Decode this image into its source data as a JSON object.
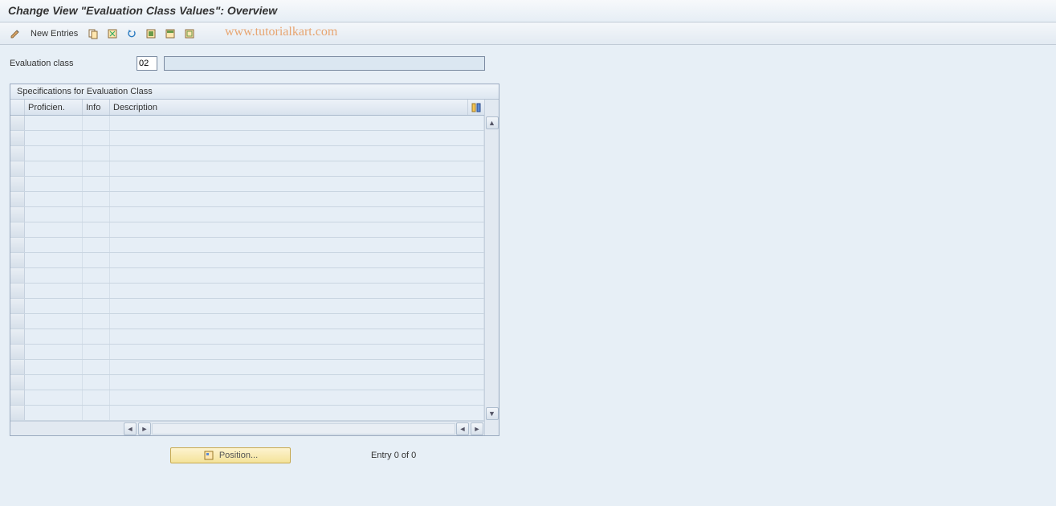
{
  "header": {
    "title": "Change View \"Evaluation Class Values\": Overview"
  },
  "toolbar": {
    "new_entries_label": "New Entries"
  },
  "watermark": "www.tutorialkart.com",
  "form": {
    "eval_class_label": "Evaluation class",
    "eval_class_value": "02",
    "eval_class_desc": ""
  },
  "panel": {
    "title": "Specifications for Evaluation Class",
    "columns": {
      "proficiency": "Proficien.",
      "info": "Info",
      "description": "Description"
    },
    "rows": [
      {
        "proficiency": "",
        "info": "",
        "description": ""
      },
      {
        "proficiency": "",
        "info": "",
        "description": ""
      },
      {
        "proficiency": "",
        "info": "",
        "description": ""
      },
      {
        "proficiency": "",
        "info": "",
        "description": ""
      },
      {
        "proficiency": "",
        "info": "",
        "description": ""
      },
      {
        "proficiency": "",
        "info": "",
        "description": ""
      },
      {
        "proficiency": "",
        "info": "",
        "description": ""
      },
      {
        "proficiency": "",
        "info": "",
        "description": ""
      },
      {
        "proficiency": "",
        "info": "",
        "description": ""
      },
      {
        "proficiency": "",
        "info": "",
        "description": ""
      },
      {
        "proficiency": "",
        "info": "",
        "description": ""
      },
      {
        "proficiency": "",
        "info": "",
        "description": ""
      },
      {
        "proficiency": "",
        "info": "",
        "description": ""
      },
      {
        "proficiency": "",
        "info": "",
        "description": ""
      },
      {
        "proficiency": "",
        "info": "",
        "description": ""
      },
      {
        "proficiency": "",
        "info": "",
        "description": ""
      },
      {
        "proficiency": "",
        "info": "",
        "description": ""
      },
      {
        "proficiency": "",
        "info": "",
        "description": ""
      },
      {
        "proficiency": "",
        "info": "",
        "description": ""
      },
      {
        "proficiency": "",
        "info": "",
        "description": ""
      }
    ]
  },
  "footer": {
    "position_label": "Position...",
    "entry_text": "Entry 0 of 0"
  }
}
